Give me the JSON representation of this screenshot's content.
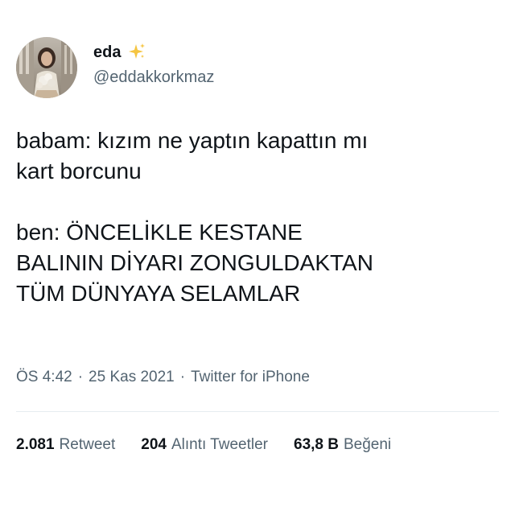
{
  "user": {
    "display_name": "eda",
    "badge_icon": "sparkles-icon",
    "handle": "@eddakkorkmaz"
  },
  "tweet": {
    "paragraphs": [
      "babam: kızım ne yaptın kapattın mı\nkart borcunu",
      "ben: ÖNCELİKLE KESTANE\nBALININ DİYARI ZONGULDAKTAN\nTÜM DÜNYAYA SELAMLAR"
    ]
  },
  "meta": {
    "time": "ÖS 4:42",
    "separator": "·",
    "date": "25 Kas 2021",
    "source": "Twitter for iPhone"
  },
  "stats": {
    "retweets": {
      "count": "2.081",
      "label": "Retweet"
    },
    "quotes": {
      "count": "204",
      "label": "Alıntı Tweetler"
    },
    "likes": {
      "count": "63,8 B",
      "label": "Beğeni"
    }
  },
  "colors": {
    "text_primary": "#0f1419",
    "text_secondary": "#536471",
    "divider": "#e6ecf0",
    "sparkle": "#f5c542"
  }
}
